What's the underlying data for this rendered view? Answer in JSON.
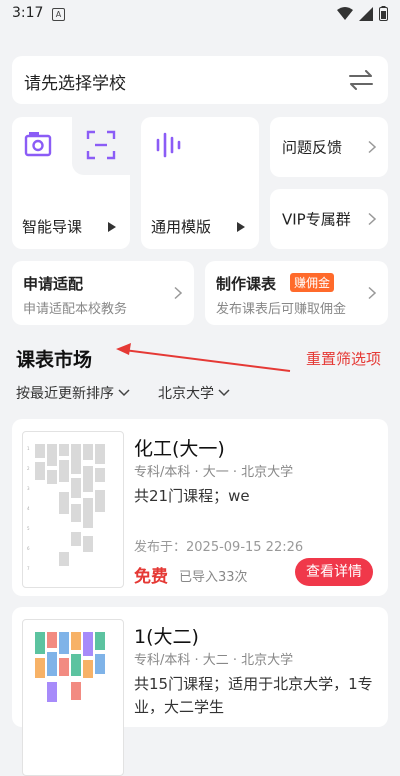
{
  "status": {
    "time": "3:17",
    "a_icon": "A"
  },
  "school_selector": {
    "label": "请先选择学校"
  },
  "tiles": {
    "smart": "智能导课",
    "general": "通用模版",
    "feedback": "问题反馈",
    "vip": "VIP专属群"
  },
  "apply": {
    "title": "申请适配",
    "sub": "申请适配本校教务"
  },
  "make": {
    "title": "制作课表",
    "badge": "赚佣金",
    "sub": "发布课表后可赚取佣金"
  },
  "market": {
    "title": "课表市场",
    "reset": "重置筛选项"
  },
  "filters": {
    "sort": "按最近更新排序",
    "school": "北京大学"
  },
  "courses": [
    {
      "title": "化工(大一)",
      "meta": "专科/本科 · 大一 · 北京大学",
      "desc": "共21门课程；we",
      "date": "发布于：2025-09-15 22:26",
      "price": "免费",
      "imported": "已导入33次",
      "button": "查看详情"
    },
    {
      "title": "1(大二)",
      "meta": "专科/本科 · 大二 · 北京大学",
      "desc": "共15门课程；适用于北京大学，1专业，大二学生"
    }
  ],
  "colors": {
    "accent": "#e53935",
    "primary_icon": "#8b5cf6",
    "badge": "#ff6a2b"
  },
  "icons": [
    "camera-icon",
    "scan-icon",
    "waveform-icon",
    "swap-icon",
    "chevron-right-icon",
    "play-icon",
    "chevron-down-icon",
    "wifi-icon",
    "battery-icon"
  ]
}
